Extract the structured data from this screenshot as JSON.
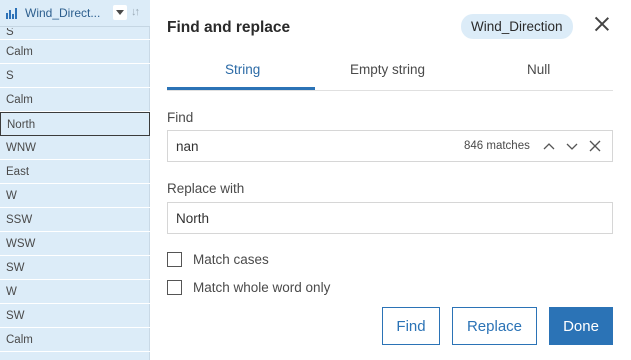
{
  "column": {
    "header_title": "Wind_Direct...",
    "cells": [
      "S",
      "Calm",
      "S",
      "Calm",
      "North",
      "WNW",
      "East",
      "W",
      "SSW",
      "WSW",
      "SW",
      "W",
      "SW",
      "Calm"
    ]
  },
  "dialog": {
    "title": "Find and replace",
    "field_chip": "Wind_Direction",
    "tabs": [
      {
        "label": "String",
        "active": true
      },
      {
        "label": "Empty string",
        "active": false
      },
      {
        "label": "Null",
        "active": false
      }
    ],
    "find": {
      "label": "Find",
      "value": "nan",
      "match_count": "846 matches"
    },
    "replace": {
      "label": "Replace with",
      "value": "North"
    },
    "options": {
      "match_cases": {
        "label": "Match cases",
        "checked": false
      },
      "match_whole_word": {
        "label": "Match whole word only",
        "checked": false
      }
    },
    "buttons": {
      "find": "Find",
      "replace": "Replace",
      "done": "Done"
    }
  },
  "colors": {
    "accent": "#2b73b6",
    "column_bg": "#dcecf8",
    "chip_bg": "#dcecf8"
  }
}
